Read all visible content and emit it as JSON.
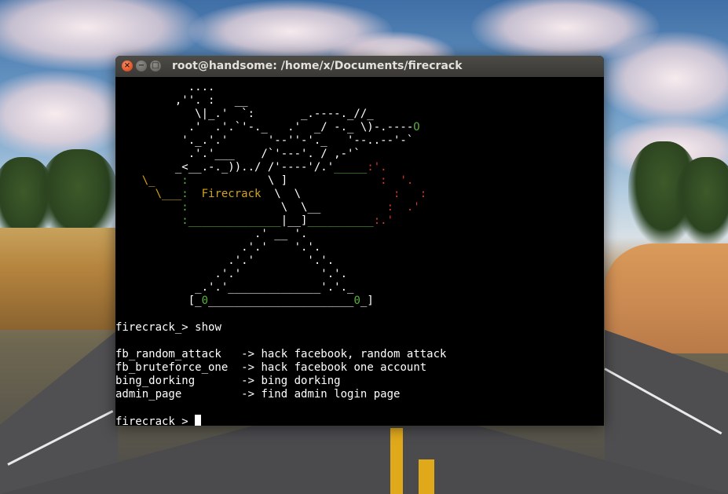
{
  "window": {
    "title": "root@handsome: /home/x/Documents/firecrack",
    "buttons": {
      "close": "×",
      "minimize": "−",
      "maximize": "□"
    }
  },
  "terminal": {
    "banner_label": "Firecrack",
    "prompt": "firecrack_>",
    "command": "show",
    "menu": [
      {
        "name": "fb_random_attack",
        "arrow": "->",
        "desc": "hack facebook, random attack"
      },
      {
        "name": "fb_bruteforce_one",
        "arrow": "->",
        "desc": "hack facebook one account"
      },
      {
        "name": "bing_dorking",
        "arrow": "->",
        "desc": "bing dorking"
      },
      {
        "name": "admin_page",
        "arrow": "->",
        "desc": "find admin login page"
      }
    ],
    "colors": {
      "banner_green": "#5ab03c",
      "banner_yellow": "#d2a21a",
      "banner_red": "#d43a2a",
      "text": "#ffffff",
      "background": "#000000"
    }
  }
}
